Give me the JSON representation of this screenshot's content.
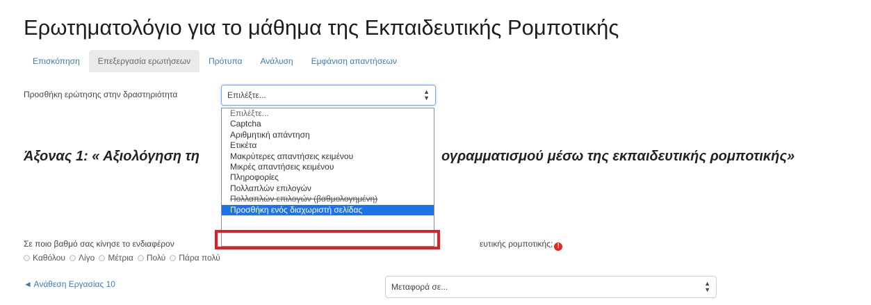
{
  "page": {
    "title": "Ερωτηματολόγιο για το μάθημα της Εκπαιδευτικής Ρομποτικής"
  },
  "tabs": [
    {
      "label": "Επισκόπηση",
      "active": false
    },
    {
      "label": "Επεξεργασία ερωτήσεων",
      "active": true
    },
    {
      "label": "Πρότυπα",
      "active": false
    },
    {
      "label": "Ανάλυση",
      "active": false
    },
    {
      "label": "Εμφάνιση απαντήσεων",
      "active": false
    }
  ],
  "add_question": {
    "label": "Προσθήκη ερώτησης στην δραστηριότητα",
    "select_value": "Επιλέξτε..."
  },
  "dropdown": {
    "items": [
      "Επιλέξτε...",
      "Captcha",
      "Αριθμητική απάντηση",
      "Ετικέτα",
      "Μακρύτερες απαντήσεις κειμένου",
      "Μικρές απαντήσεις κειμένου",
      "Πληροφορίες",
      "Πολλαπλών επιλογών",
      "Πολλαπλών επιλογών (βαθμολογημένη)",
      "Προσθήκη ενός διαχωριστή σελίδας"
    ],
    "selected_index": 9
  },
  "section": {
    "heading_left": "Άξονας 1: « Αξιολόγηση τη",
    "heading_right": "ογραμματισμού μέσω της εκπαιδευτικής ρομποτικής»"
  },
  "question": {
    "text_left": "Σε ποιο βαθμό σας κίνησε το ενδιαφέρον",
    "text_right": "ευτικής ρομποτικής;",
    "options": [
      "Καθόλου",
      "Λίγο",
      "Μέτρια",
      "Πολύ",
      "Πάρα πολύ"
    ]
  },
  "navigation": {
    "back_link": "◄ Ανάθεση Εργασίας 10",
    "jump_select": "Μεταφορά σε..."
  },
  "colors": {
    "link": "#3a7bbf",
    "selected_option": "#1e73e8",
    "highlight": "#e21d26",
    "required": "#e02b20"
  },
  "icons": {
    "select_chevron": "⇕",
    "required": "!"
  }
}
